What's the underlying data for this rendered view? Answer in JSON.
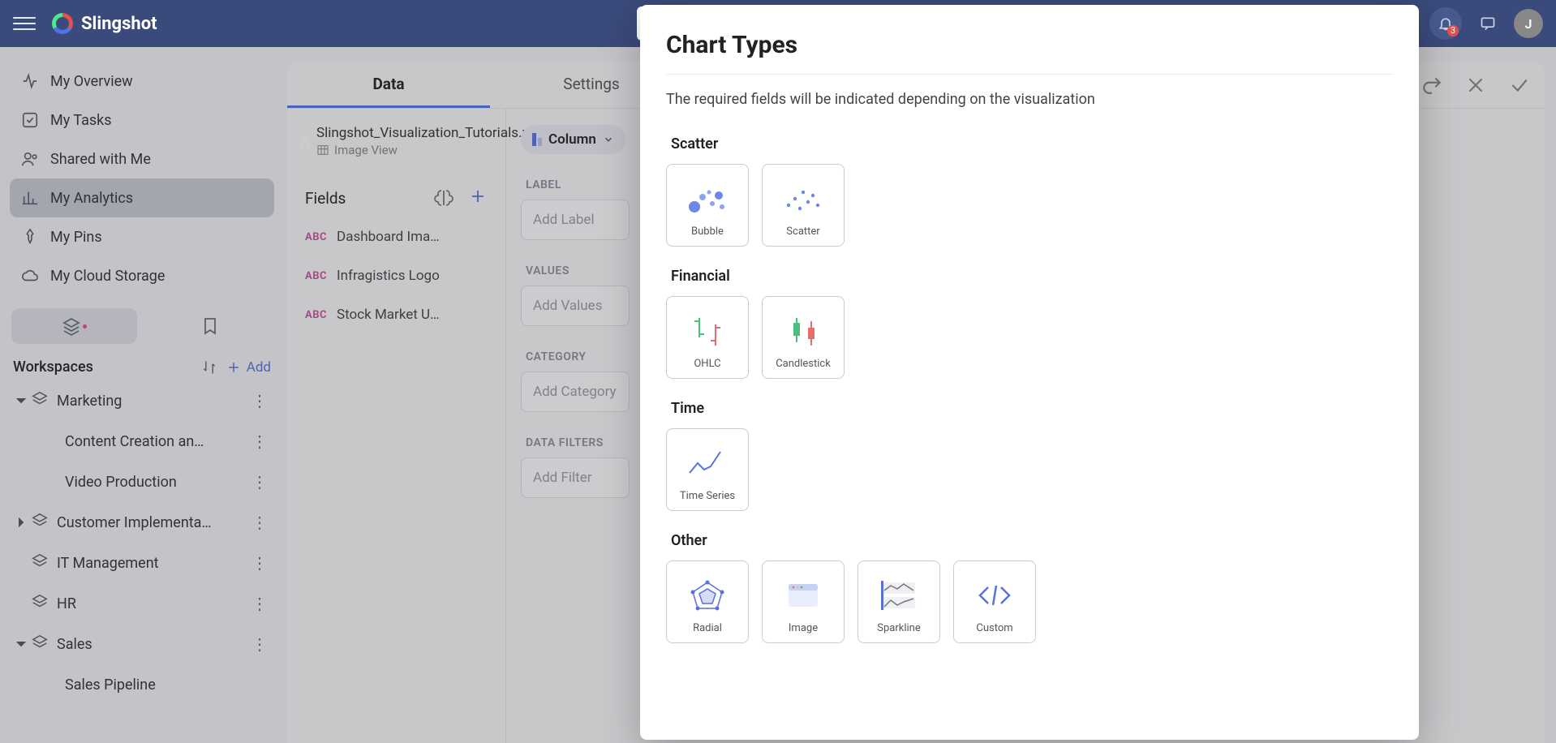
{
  "app": {
    "name": "Slingshot",
    "avatar_initial": "J",
    "notification_count": "3"
  },
  "sidebar": {
    "items": [
      {
        "label": "My Overview"
      },
      {
        "label": "My Tasks"
      },
      {
        "label": "Shared with Me"
      },
      {
        "label": "My Analytics"
      },
      {
        "label": "My Pins"
      },
      {
        "label": "My Cloud Storage"
      }
    ],
    "workspaces_header": "Workspaces",
    "add_label": "Add",
    "workspaces": [
      {
        "label": "Marketing",
        "expanded": true,
        "children": [
          {
            "label": "Content Creation an…"
          },
          {
            "label": "Video Production"
          }
        ]
      },
      {
        "label": "Customer Implementa…",
        "collapsed_caret": true
      },
      {
        "label": "IT Management"
      },
      {
        "label": "HR"
      },
      {
        "label": "Sales",
        "expanded": true,
        "children": [
          {
            "label": "Sales Pipeline"
          }
        ]
      }
    ]
  },
  "editor": {
    "tabs": [
      {
        "label": "Data",
        "active": true
      },
      {
        "label": "Settings"
      }
    ],
    "file": {
      "name": "Slingshot_Visualization_Tutorials.xlsx",
      "sheet": "Image View"
    },
    "fields_header": "Fields",
    "fields": [
      {
        "label": "Dashboard Ima…"
      },
      {
        "label": "Infragistics Logo"
      },
      {
        "label": "Stock Market U…"
      }
    ],
    "chart_selector": "Column",
    "sections": {
      "label": {
        "title": "LABEL",
        "placeholder": "Add Label"
      },
      "values": {
        "title": "VALUES",
        "placeholder": "Add Values"
      },
      "category": {
        "title": "CATEGORY",
        "placeholder": "Add Category"
      },
      "filters": {
        "title": "DATA FILTERS",
        "placeholder": "Add Filter"
      }
    }
  },
  "chart_types": {
    "title": "Chart Types",
    "hint": "The required fields will be indicated depending on the visualization",
    "groups": [
      {
        "title": "Scatter",
        "items": [
          {
            "label": "Bubble"
          },
          {
            "label": "Scatter"
          }
        ]
      },
      {
        "title": "Financial",
        "items": [
          {
            "label": "OHLC"
          },
          {
            "label": "Candlestick"
          }
        ]
      },
      {
        "title": "Time",
        "items": [
          {
            "label": "Time Series"
          }
        ]
      },
      {
        "title": "Other",
        "items": [
          {
            "label": "Radial"
          },
          {
            "label": "Image"
          },
          {
            "label": "Sparkline"
          },
          {
            "label": "Custom"
          }
        ]
      }
    ]
  }
}
